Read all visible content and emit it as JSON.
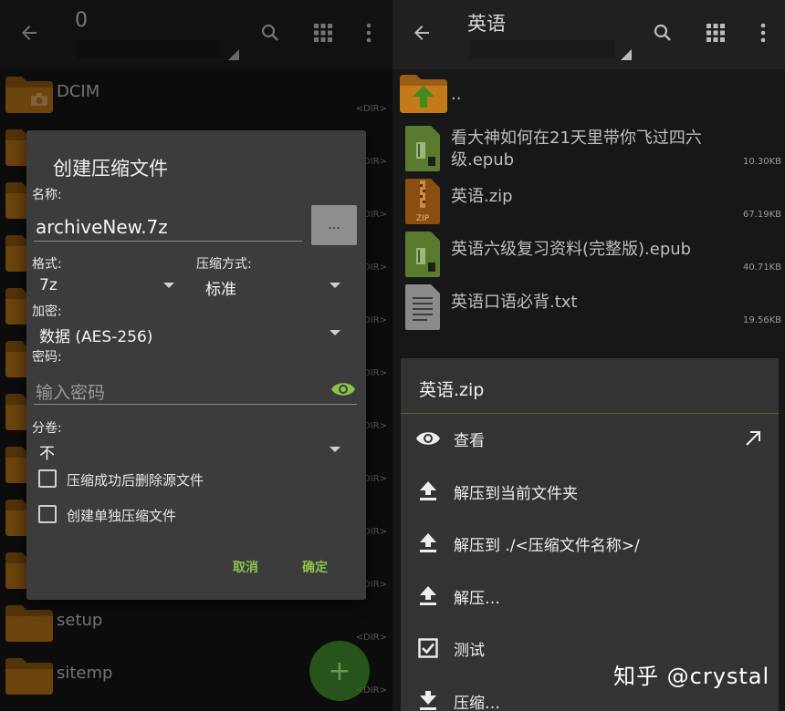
{
  "left_panel": {
    "path_title": "0",
    "folders": [
      {
        "name": "DCIM",
        "tag": "<DIR>",
        "icon": "camera-folder-icon"
      },
      {
        "name": "",
        "tag": "<DIR>"
      },
      {
        "name": "",
        "tag": "<DIR>"
      },
      {
        "name": "",
        "tag": "<DIR>"
      },
      {
        "name": "",
        "tag": "<DIR>"
      },
      {
        "name": "",
        "tag": "<DIR>"
      },
      {
        "name": "",
        "tag": "<DIR>"
      },
      {
        "name": "",
        "tag": "<DIR>"
      },
      {
        "name": "",
        "tag": "<DIR>"
      },
      {
        "name": "",
        "tag": "<DIR>"
      },
      {
        "name": "setup",
        "tag": "<DIR>"
      },
      {
        "name": "sitemp",
        "tag": "<DIR>"
      }
    ],
    "fab_label": "+"
  },
  "dialog": {
    "title": "创建压缩文件",
    "name_label": "名称:",
    "name_value": "archiveNew.7z",
    "browse_label": "...",
    "format_label": "格式:",
    "format_value": "7z",
    "method_label": "压缩方式:",
    "method_value": "标准",
    "encryption_label": "加密:",
    "encryption_value": "数据 (AES-256)",
    "password_label": "密码:",
    "password_placeholder": "输入密码",
    "split_label": "分卷:",
    "split_value": "不",
    "option_delete": "压缩成功后删除源文件",
    "option_single": "创建单独压缩文件",
    "cancel": "取消",
    "ok": "确定",
    "accent_color": "#8bc34a"
  },
  "right_panel": {
    "path_title": "英语",
    "files": [
      {
        "name": "..",
        "size": "",
        "icon": "parent-folder-icon"
      },
      {
        "name": "看大神如何在21天里带你飞过四六级.epub",
        "size": "10.30KB",
        "icon": "epub-file-icon"
      },
      {
        "name": "英语.zip",
        "size": "67.19KB",
        "icon": "zip-file-icon"
      },
      {
        "name": "英语六级复习资料(完整版).epub",
        "size": "40.71KB",
        "icon": "epub-file-icon"
      },
      {
        "name": "英语口语必背.txt",
        "size": "19.56KB",
        "icon": "text-file-icon"
      }
    ]
  },
  "context_menu": {
    "title": "英语.zip",
    "items": [
      {
        "label": "查看",
        "icon": "eye-icon"
      },
      {
        "label": "解压到当前文件夹",
        "icon": "extract-icon"
      },
      {
        "label": "解压到 ./<压缩文件名称>/",
        "icon": "extract-icon"
      },
      {
        "label": "解压…",
        "icon": "extract-icon"
      },
      {
        "label": "测试",
        "icon": "checkbox-icon"
      },
      {
        "label": "压缩…",
        "icon": "compress-icon"
      }
    ]
  },
  "watermark": "知乎 @crystal"
}
